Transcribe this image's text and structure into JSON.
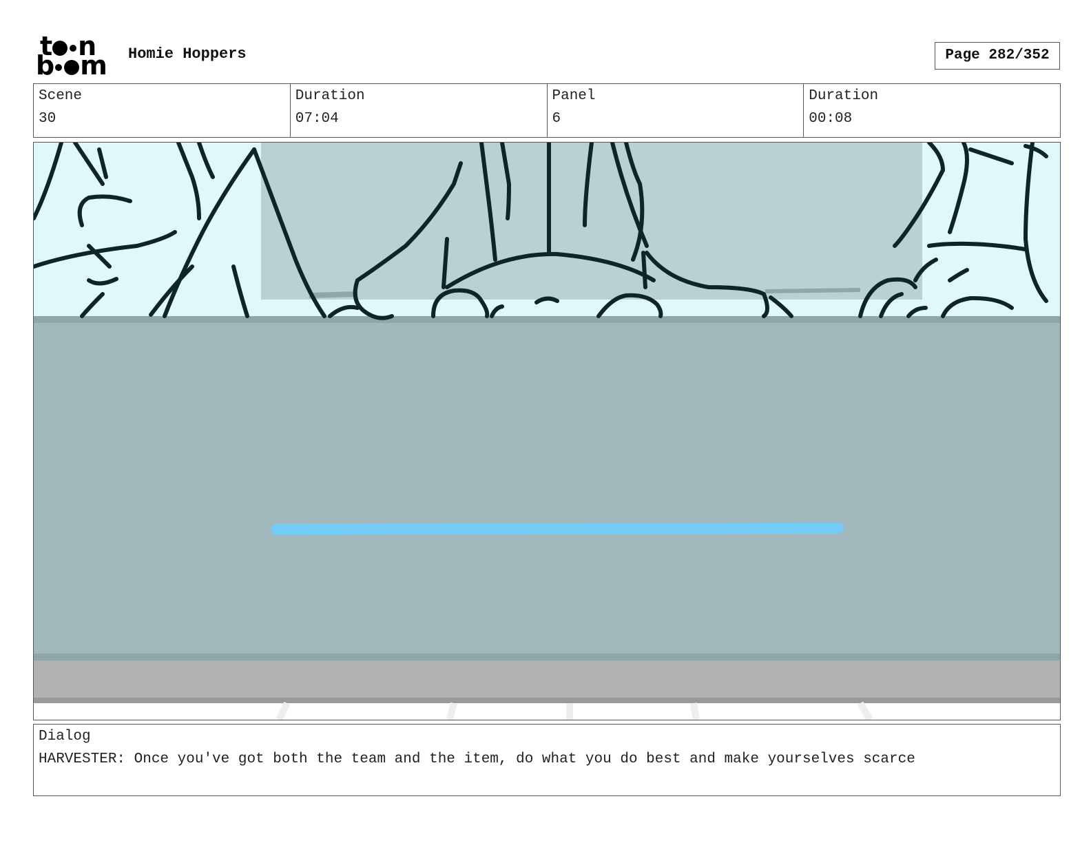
{
  "header": {
    "logo_top": "t  n",
    "logo_bottom": "b  m",
    "project_title": "Homie Hoppers",
    "page_label": "Page 282/352"
  },
  "info": [
    {
      "label": "Scene",
      "value": "30"
    },
    {
      "label": "Duration",
      "value": "07:04"
    },
    {
      "label": "Panel",
      "value": "6"
    },
    {
      "label": "Duration",
      "value": "00:08"
    }
  ],
  "panel": {
    "colors": {
      "sky": "#e0f8fb",
      "backdrop": "#b7d1d4",
      "counter": "#a1b9bc",
      "counter_edge": "#8fa7aa",
      "floor": "#b2b2b2",
      "floor_edge": "#999999",
      "line": "#0c2528",
      "highlight": "#74cbf6"
    }
  },
  "dialog": {
    "label": "Dialog",
    "text": "HARVESTER: Once you've got both the team and the item, do what you do best and make yourselves scarce"
  }
}
